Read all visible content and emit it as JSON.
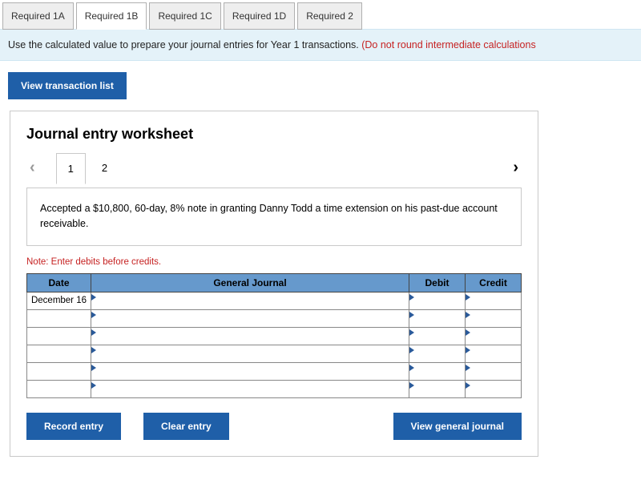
{
  "tabs": {
    "items": [
      {
        "label": "Required 1A",
        "active": false
      },
      {
        "label": "Required 1B",
        "active": true
      },
      {
        "label": "Required 1C",
        "active": false
      },
      {
        "label": "Required 1D",
        "active": false
      },
      {
        "label": "Required 2",
        "active": false
      }
    ]
  },
  "instruction": {
    "main": "Use the calculated value to prepare your journal entries for Year 1 transactions. ",
    "warn": "(Do not round intermediate calculations"
  },
  "buttons": {
    "view_transactions": "View transaction list",
    "record": "Record entry",
    "clear": "Clear entry",
    "view_journal": "View general journal"
  },
  "worksheet": {
    "title": "Journal entry worksheet",
    "steps": [
      {
        "label": "1",
        "active": true
      },
      {
        "label": "2",
        "active": false
      }
    ],
    "description": "Accepted a $10,800, 60-day, 8% note in granting Danny Todd a time extension on his past-due account receivable.",
    "note": "Note: Enter debits before credits.",
    "headers": {
      "date": "Date",
      "gj": "General Journal",
      "debit": "Debit",
      "credit": "Credit"
    },
    "rows": [
      {
        "date": "December 16",
        "gj": "",
        "debit": "",
        "credit": ""
      },
      {
        "date": "",
        "gj": "",
        "debit": "",
        "credit": ""
      },
      {
        "date": "",
        "gj": "",
        "debit": "",
        "credit": ""
      },
      {
        "date": "",
        "gj": "",
        "debit": "",
        "credit": ""
      },
      {
        "date": "",
        "gj": "",
        "debit": "",
        "credit": ""
      },
      {
        "date": "",
        "gj": "",
        "debit": "",
        "credit": ""
      }
    ]
  }
}
